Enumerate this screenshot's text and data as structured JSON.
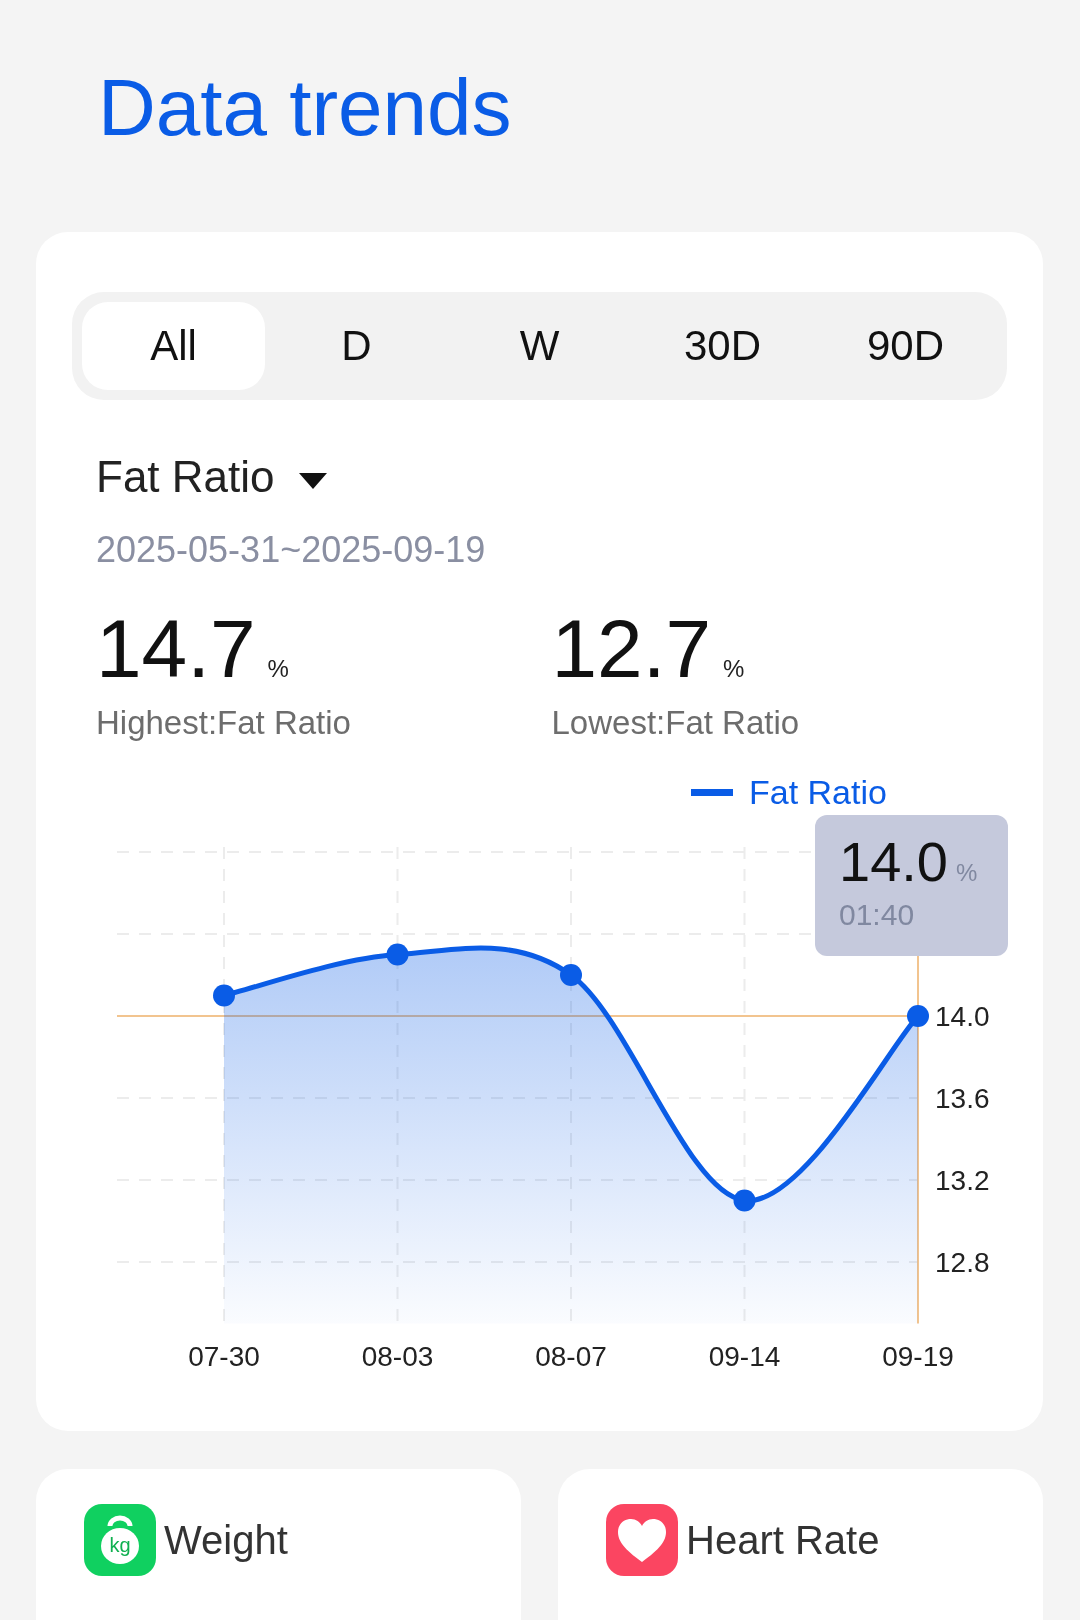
{
  "title": "Data trends",
  "tabs": [
    {
      "label": "All",
      "selected": true
    },
    {
      "label": "D",
      "selected": false
    },
    {
      "label": "W",
      "selected": false
    },
    {
      "label": "30D",
      "selected": false
    },
    {
      "label": "90D",
      "selected": false
    }
  ],
  "metric": {
    "label": "Fat Ratio",
    "date_range": "2025-05-31~2025-09-19"
  },
  "stats": [
    {
      "value": "14.7",
      "unit": "%",
      "label": "Highest:Fat Ratio"
    },
    {
      "value": "12.7",
      "unit": "%",
      "label": "Lowest:Fat Ratio"
    }
  ],
  "chart": {
    "tooltip": {
      "value": "14.0",
      "unit": "%",
      "time": "01:40"
    },
    "chart_data": {
      "type": "area",
      "categories": [
        "07-30",
        "08-03",
        "08-07",
        "09-14",
        "09-19"
      ],
      "series": [
        {
          "name": "Fat Ratio",
          "color": "#0a5ce6",
          "values": [
            14.1,
            14.3,
            14.2,
            13.1,
            14.0
          ]
        }
      ],
      "ylim": [
        12.5,
        14.8
      ],
      "grid": true,
      "ref_lines": [
        {
          "axis": "y",
          "value": 14.0,
          "color": "#f2c48f"
        }
      ],
      "yticks": [
        {
          "value": 12.8,
          "label": "12.8"
        },
        {
          "value": 13.2,
          "label": "13.2"
        },
        {
          "value": 13.6,
          "label": "13.6"
        },
        {
          "value": 14,
          "label": "14.0"
        }
      ]
    }
  },
  "cards": [
    {
      "kind": "weight",
      "label": "Weight",
      "icon_text": "kg"
    },
    {
      "kind": "heart",
      "label": "Heart Rate"
    }
  ]
}
